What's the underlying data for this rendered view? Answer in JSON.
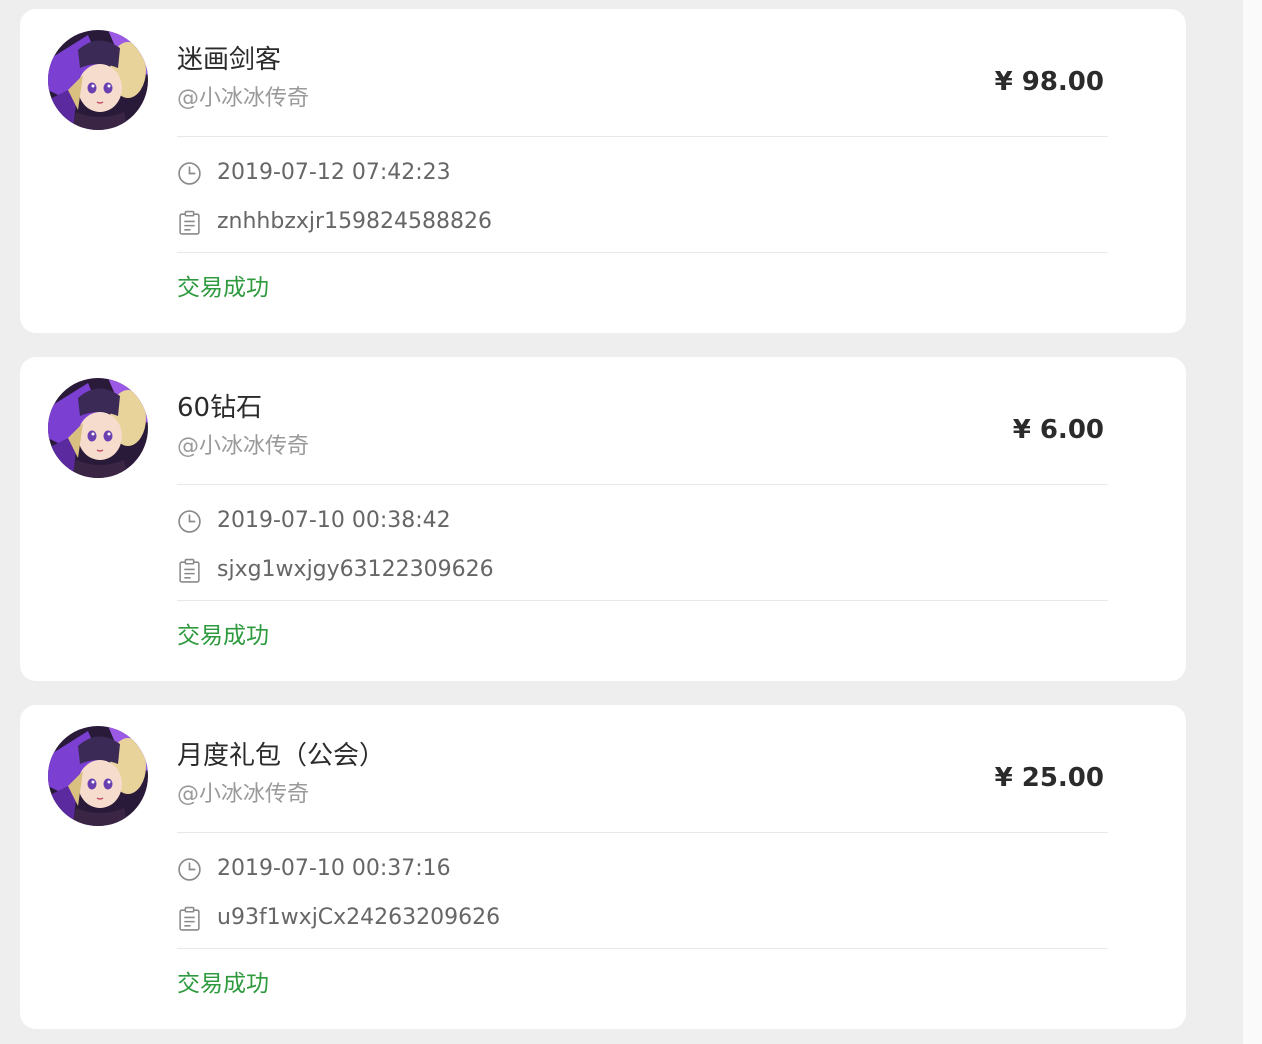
{
  "orders": [
    {
      "title": "迷画剑客",
      "seller": "@小冰冰传奇",
      "price": "¥ 98.00",
      "time": "2019-07-12 07:42:23",
      "order_no": "znhhbzxjr159824588826",
      "status": "交易成功"
    },
    {
      "title": "60钻石",
      "seller": "@小冰冰传奇",
      "price": "¥ 6.00",
      "time": "2019-07-10 00:38:42",
      "order_no": "sjxg1wxjgy63122309626",
      "status": "交易成功"
    },
    {
      "title": "月度礼包（公会）",
      "seller": "@小冰冰传奇",
      "price": "¥ 25.00",
      "time": "2019-07-10 00:37:16",
      "order_no": "u93f1wxjCx24263209626",
      "status": "交易成功"
    }
  ],
  "icons": {
    "time": "clock-icon",
    "order_no": "clipboard-icon"
  },
  "colors": {
    "status": "#2e9a3e",
    "background": "#eeeeee",
    "card": "#ffffff"
  }
}
